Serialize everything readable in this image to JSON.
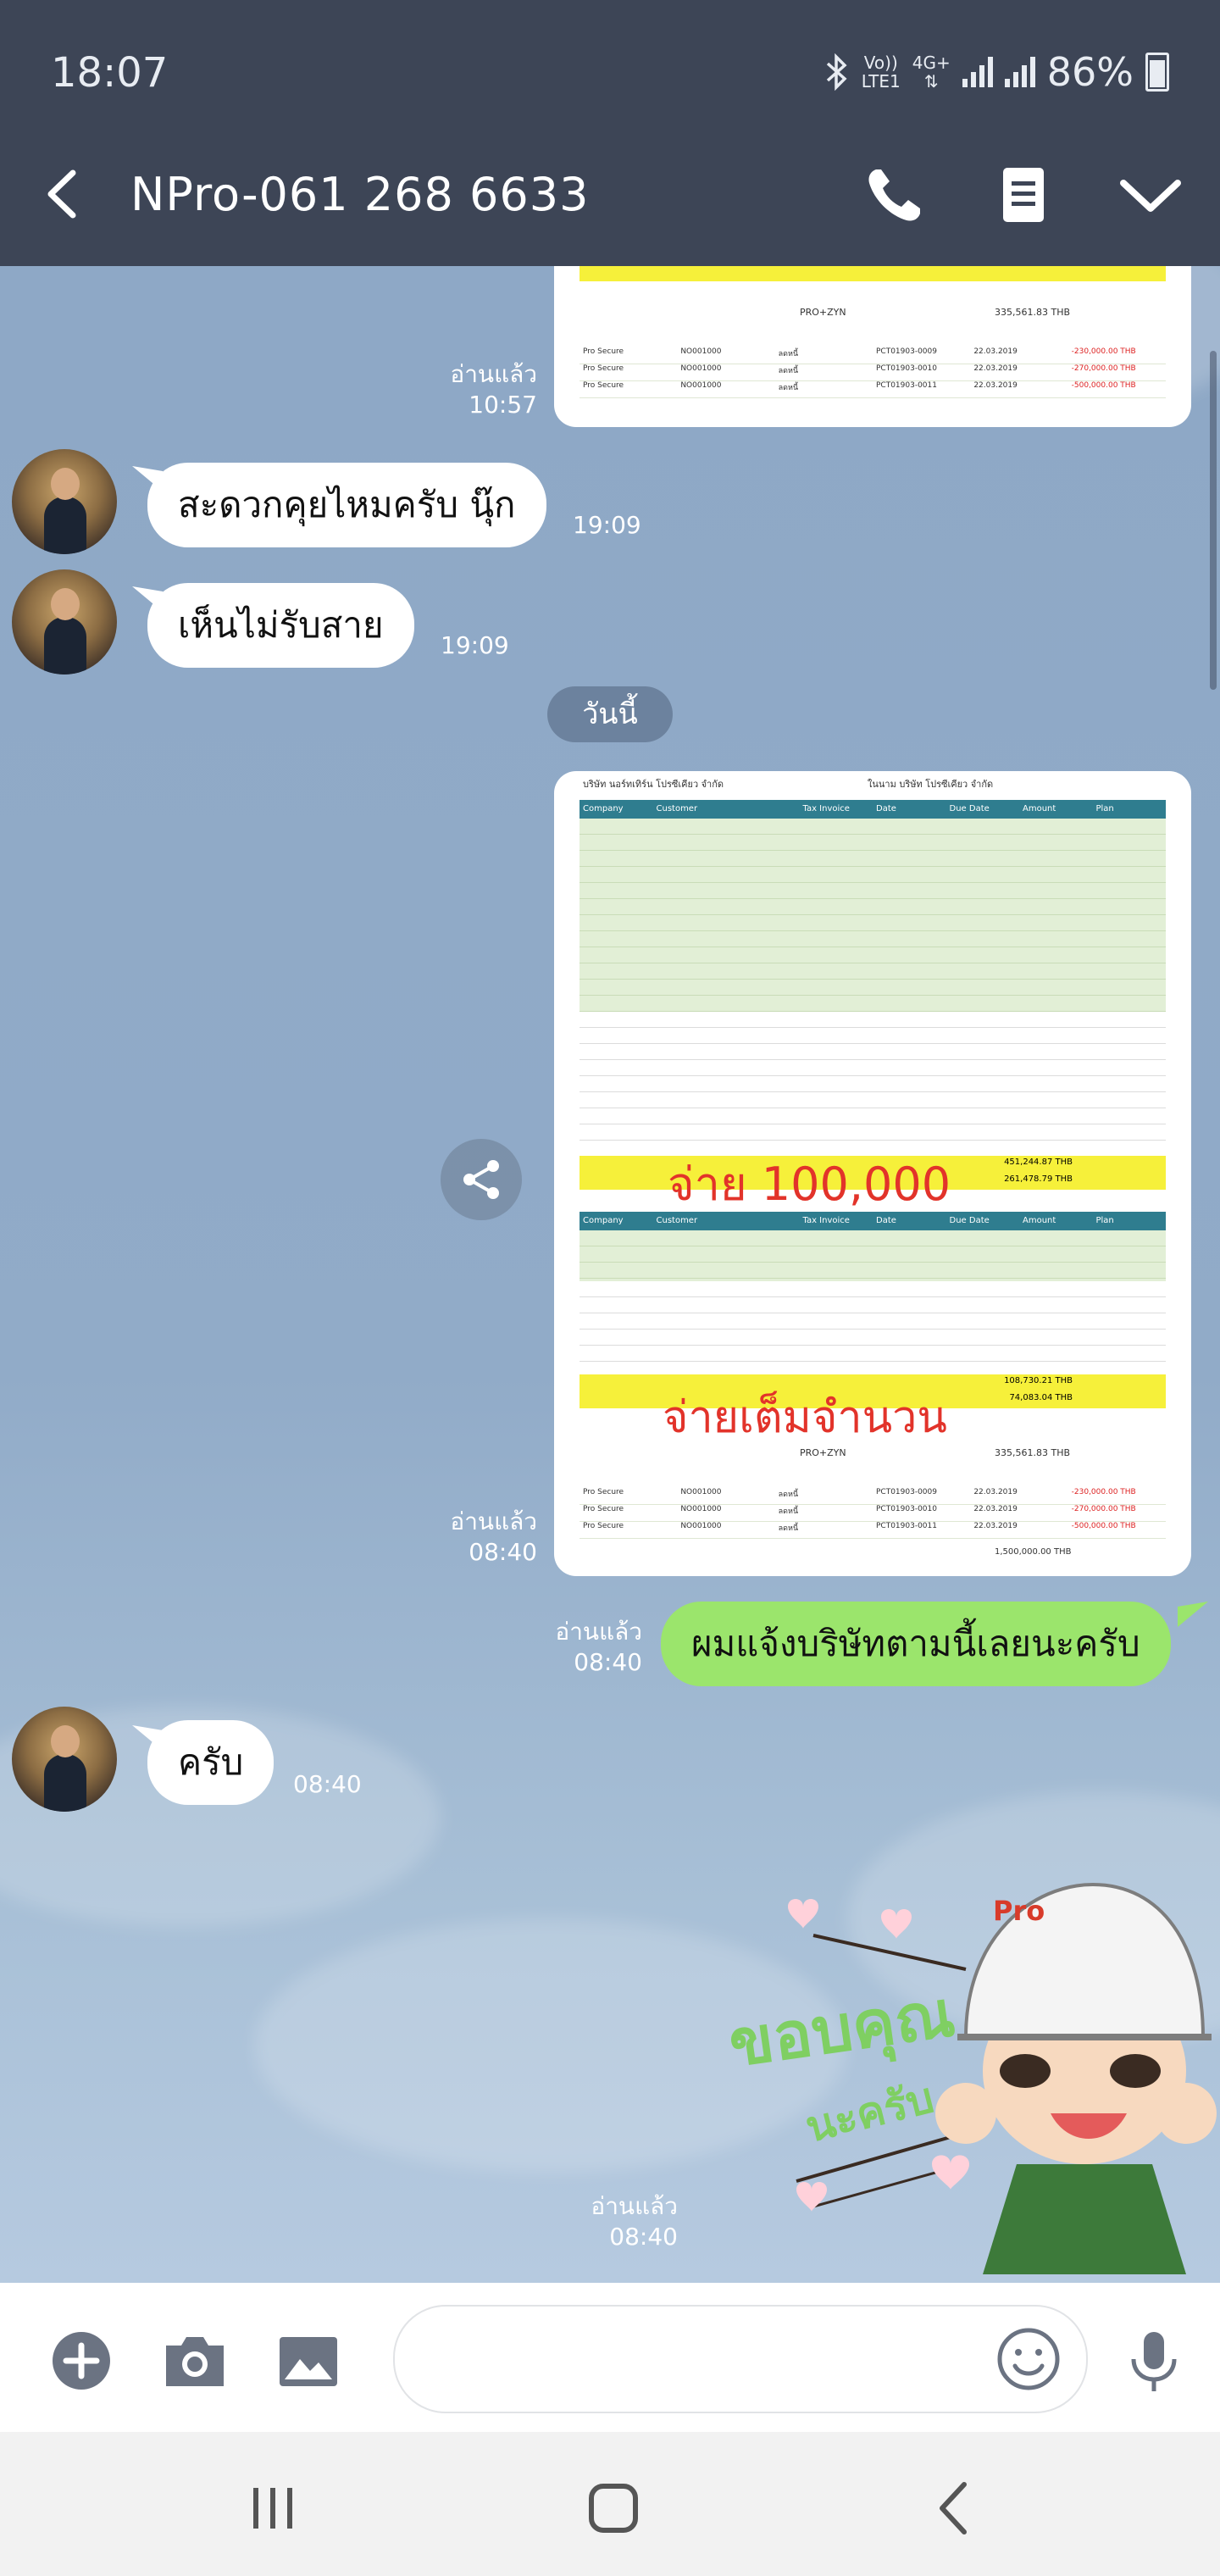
{
  "status_bar": {
    "time": "18:07",
    "network_top": "Vo))",
    "network_bottom": "LTE1",
    "network_type": "4G+",
    "battery": "86%"
  },
  "header": {
    "title": "NPro-061 268 6633",
    "back_icon": "chevron-left-icon",
    "call_icon": "phone-icon",
    "notes_icon": "note-icon",
    "menu_icon": "chevron-down-icon"
  },
  "messages": {
    "m1_read": "อ่านแล้ว",
    "m1_time": "10:57",
    "m1_sheet": {
      "total_line": "PRO+ZYN",
      "total_value": "335,561.83 THB"
    },
    "m2_text": "สะดวกคุยไหมครับ นุ๊ก",
    "m2_time": "19:09",
    "m3_text": "เห็นไม่รับสาย",
    "m3_time": "19:09",
    "date_divider": "วันนี้",
    "m4_read": "อ่านแล้ว",
    "m4_time": "08:40",
    "m4_sheet": {
      "title_left": "บริษัท นอร์ทเทิร์น โปรซีเคียว จำกัด",
      "title_right": "ในนาม บริษัท โปรซีเคียว จำกัด",
      "headers": [
        "Company",
        "Customer",
        "",
        "Tax Invoice",
        "Date",
        "Due Date",
        "Amount",
        "Plan"
      ],
      "annotation_1": "จ่าย 100,000",
      "annotation_2": "จ่ายเต็มจำนวน",
      "pro_total": "451,244.87 THB",
      "pro_total_2": "261,478.79 THB",
      "zyn_total": "108,730.21 THB",
      "zyn_total_2": "74,083.04 THB",
      "grand_label": "PRO+ZYN",
      "grand_total": "335,561.83 THB",
      "final_total": "1,500,000.00 THB"
    },
    "m5_text": "ผมแจ้งบริษัทตามนี้เลยนะครับ",
    "m5_read": "อ่านแล้ว",
    "m5_time": "08:40",
    "m6_text": "ครับ",
    "m6_time": "08:40",
    "sticker_text_1": "ขอบคุณ",
    "sticker_text_2": "นะครับ",
    "sticker_brand": "Pro",
    "m7_read": "อ่านแล้ว",
    "m7_time": "08:40"
  },
  "input_bar": {
    "add_icon": "plus-circle-icon",
    "camera_icon": "camera-icon",
    "gallery_icon": "image-icon",
    "emoji_icon": "emoji-icon",
    "mic_icon": "microphone-icon",
    "placeholder": ""
  },
  "nav_bar": {
    "recent_icon": "recent-apps-icon",
    "home_icon": "home-icon",
    "back_icon": "back-icon"
  },
  "colors": {
    "bar_bg": "#3d4556",
    "chat_bg": "#8ea8c6",
    "my_bubble": "#9be56c",
    "their_bubble": "#ffffff",
    "sheet_header": "#2f7d8f"
  }
}
